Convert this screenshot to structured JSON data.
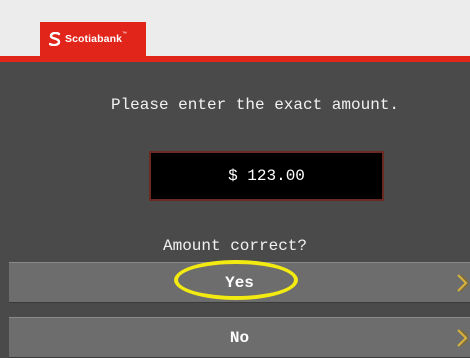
{
  "brand": {
    "name": "Scotiabank",
    "trademark": "™"
  },
  "screen": {
    "prompt": "Please enter the exact amount.",
    "amount": "$ 123.00",
    "question": "Amount correct?"
  },
  "options": [
    {
      "label": "Yes",
      "icon": "chevron-right-icon"
    },
    {
      "label": "No",
      "icon": "chevron-right-icon"
    }
  ],
  "colors": {
    "brand_red": "#e1251b",
    "screen_bg": "#4a4a4a",
    "option_bg": "#6d6d6d",
    "highlight": "#f3ea12",
    "chevron": "#d9b23a"
  }
}
